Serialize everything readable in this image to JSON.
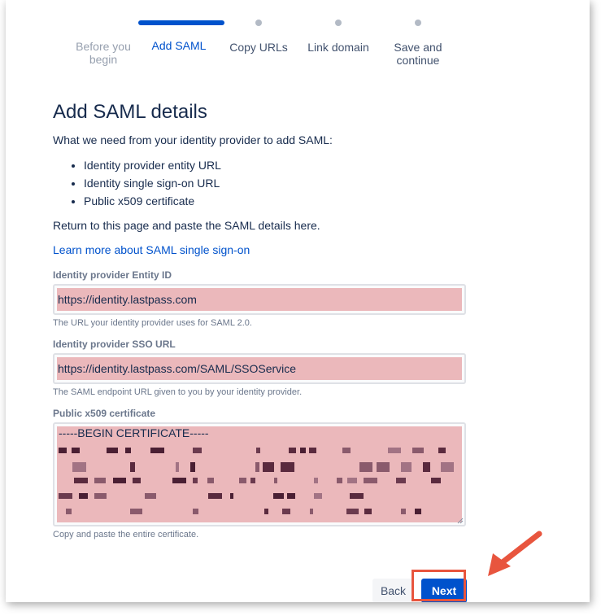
{
  "stepper": {
    "steps": [
      {
        "label": "Before you begin",
        "state": "done"
      },
      {
        "label": "Add SAML",
        "state": "active"
      },
      {
        "label": "Copy URLs",
        "state": "upcoming"
      },
      {
        "label": "Link domain",
        "state": "upcoming"
      },
      {
        "label": "Save and continue",
        "state": "upcoming"
      }
    ]
  },
  "page": {
    "title": "Add SAML details",
    "intro": "What we need from your identity provider to add SAML:",
    "requirements": [
      "Identity provider entity URL",
      "Identity single sign-on URL",
      "Public x509 certificate"
    ],
    "return_note": "Return to this page and paste the SAML details here.",
    "learn_more_link": "Learn more about SAML single sign-on"
  },
  "form": {
    "entity_id": {
      "label": "Identity provider Entity ID",
      "value": "https://identity.lastpass.com",
      "help": "The URL your identity provider uses for SAML 2.0."
    },
    "sso_url": {
      "label": "Identity provider SSO URL",
      "value": "https://identity.lastpass.com/SAML/SSOService",
      "help": "The SAML endpoint URL given to you by your identity provider."
    },
    "certificate": {
      "label": "Public x509 certificate",
      "value_first_line": "-----BEGIN CERTIFICATE-----",
      "help": "Copy and paste the entire certificate."
    }
  },
  "actions": {
    "back_label": "Back",
    "next_label": "Next"
  },
  "colors": {
    "accent": "#0052cc",
    "highlight_fill": "#ebb8bb",
    "annotation": "#e8553e"
  }
}
